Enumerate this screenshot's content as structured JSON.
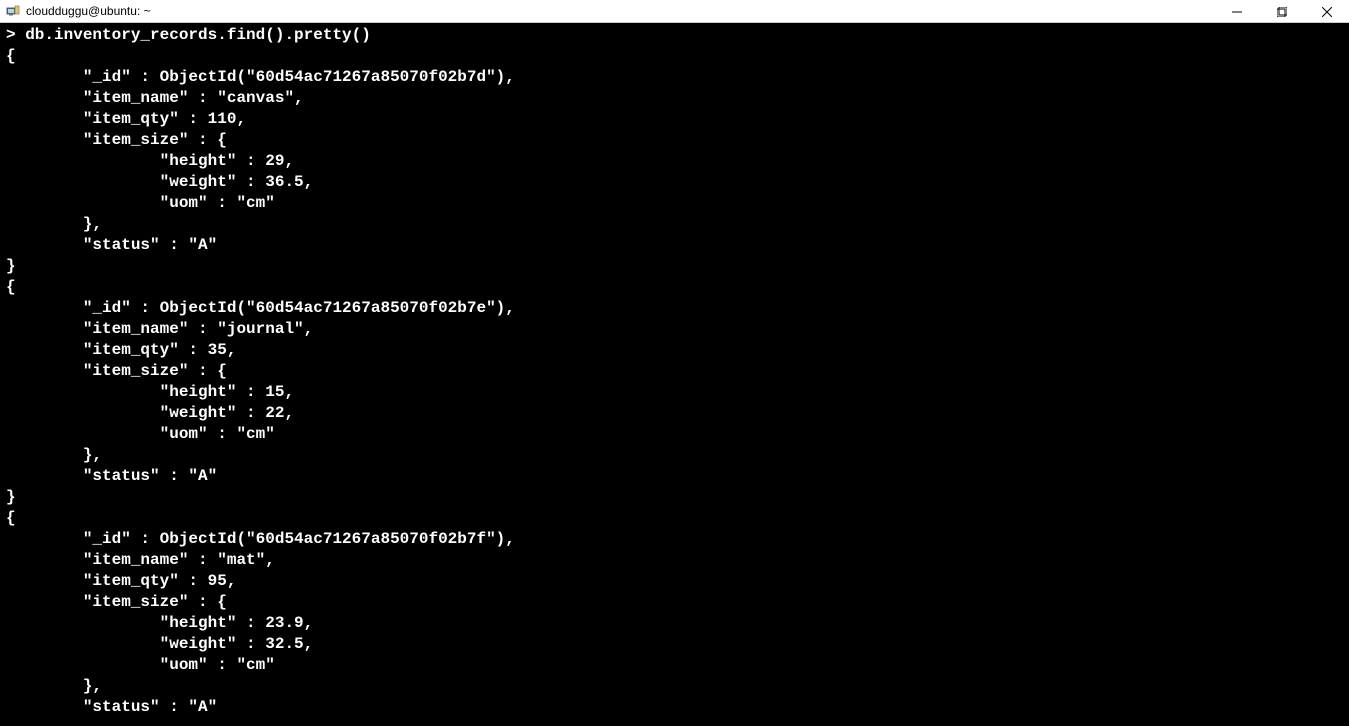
{
  "window": {
    "title": "cloudduggu@ubuntu: ~"
  },
  "terminal": {
    "prompt": "> ",
    "command": "db.inventory_records.find().pretty()",
    "records": [
      {
        "_id": "60d54ac71267a85070f02b7d",
        "item_name": "canvas",
        "item_qty": 110,
        "item_size": {
          "height": 29,
          "weight": 36.5,
          "uom": "cm"
        },
        "status": "A"
      },
      {
        "_id": "60d54ac71267a85070f02b7e",
        "item_name": "journal",
        "item_qty": 35,
        "item_size": {
          "height": 15,
          "weight": 22,
          "uom": "cm"
        },
        "status": "A"
      },
      {
        "_id": "60d54ac71267a85070f02b7f",
        "item_name": "mat",
        "item_qty": 95,
        "item_size": {
          "height": 23.9,
          "weight": 32.5,
          "uom": "cm"
        },
        "status": "A"
      }
    ]
  }
}
